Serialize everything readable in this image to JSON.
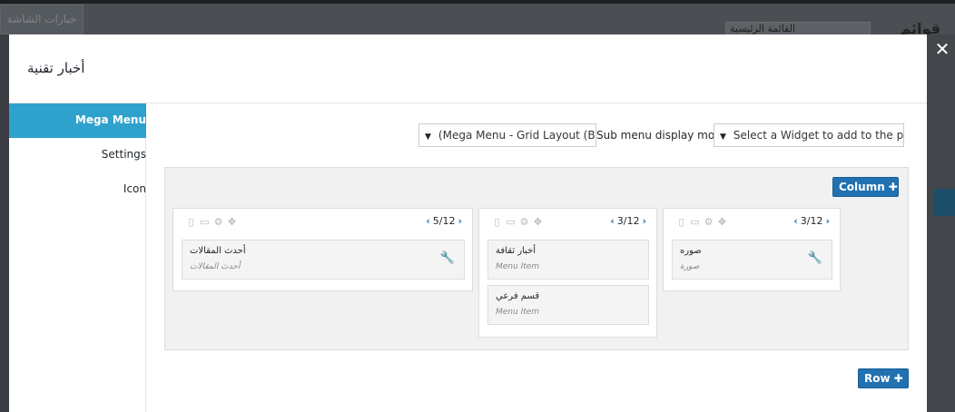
{
  "background": {
    "tab_label": "خيارات الشاشة",
    "page_title": "قوائم",
    "input_text": "القائمة الرئيسية"
  },
  "modal": {
    "title": "أخبار تقنية",
    "close_glyph": "✕"
  },
  "sidebar": {
    "items": [
      {
        "label": "Mega Menu",
        "active": true
      },
      {
        "label": "Settings",
        "active": false
      },
      {
        "label": "Icon",
        "active": false
      }
    ]
  },
  "toolbar": {
    "display_mode_value": "(Mega Menu - Grid Layout (Beta",
    "display_mode_label": "Sub menu display mode",
    "widget_select_value": "Select a Widget to add to the panel",
    "arrow_glyph": "▼"
  },
  "buttons": {
    "column_label": "Column",
    "row_label": "Row",
    "plus_glyph": "✚"
  },
  "columns": [
    {
      "size": "5/12",
      "items": [
        {
          "title": "أحدث المقالات",
          "type": "أحدث المقالات"
        }
      ]
    },
    {
      "size": "3/12",
      "items": [
        {
          "title": "أخبار ثقافة",
          "type": "Menu Item"
        },
        {
          "title": "قسم فرعي",
          "type": "Menu Item"
        }
      ]
    },
    {
      "size": "3/12",
      "items": [
        {
          "title": "صوره",
          "type": "صورة"
        }
      ]
    }
  ],
  "icons": {
    "column_toolbar": [
      "mobile-icon",
      "desktop-icon",
      "gear-icon",
      "move-icon"
    ],
    "chevron_left": "‹",
    "chevron_right": "›",
    "wrench": "🔧"
  },
  "colors": {
    "accent": "#2ea2cc",
    "button": "#2271b1"
  }
}
